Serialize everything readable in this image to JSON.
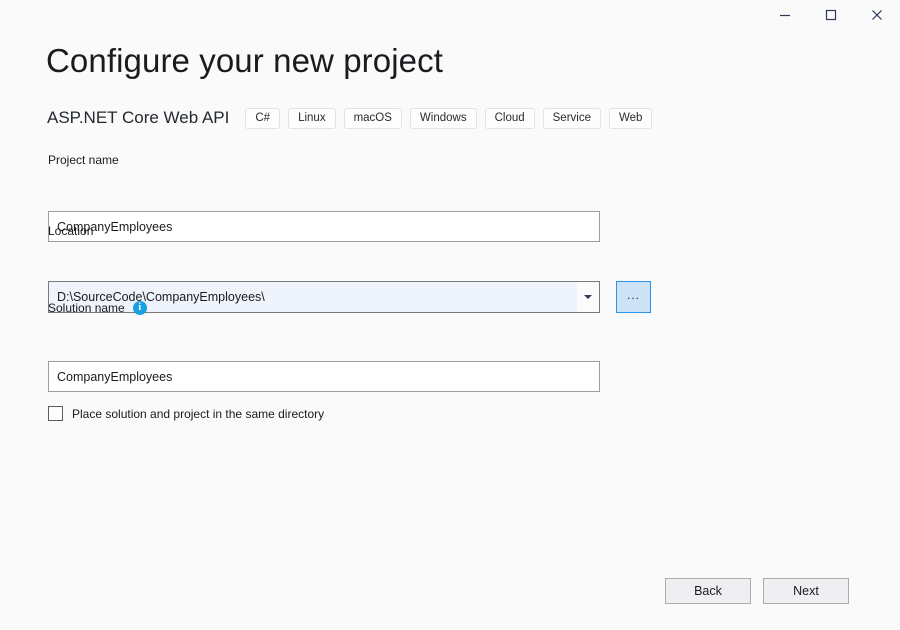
{
  "window": {
    "controls": [
      {
        "name": "minimize",
        "icon": "minimize-icon",
        "tooltip": "Minimize"
      },
      {
        "name": "maximize",
        "icon": "maximize-icon",
        "tooltip": "Maximize"
      },
      {
        "name": "close",
        "icon": "close-icon",
        "tooltip": "Close"
      }
    ]
  },
  "header": {
    "title": "Configure your new project",
    "template_name": "ASP.NET Core Web API",
    "tags": [
      "C#",
      "Linux",
      "macOS",
      "Windows",
      "Cloud",
      "Service",
      "Web"
    ]
  },
  "form": {
    "project_name": {
      "label": "Project name",
      "value": "CompanyEmployees",
      "placeholder": "Project name"
    },
    "location": {
      "label": "Location",
      "value": "D:\\SourceCode\\CompanyEmployees\\",
      "dropdown_icon": "chevron-down-icon",
      "browse_label": "...",
      "browse_icon": "ellipsis-icon"
    },
    "solution_name": {
      "label": "Solution name",
      "info_icon": "info-icon",
      "info_glyph": "i",
      "value": "CompanyEmployees",
      "placeholder": "Solution name"
    },
    "same_directory": {
      "label": "Place solution and project in the same directory",
      "checked": false
    }
  },
  "footer": {
    "back_label": "Back",
    "next_label": "Next"
  },
  "colors": {
    "page_background": "#fafafa",
    "accent_blue": "#0078d7",
    "info_blue": "#1ba1e2",
    "combo_fill": "#eff3fc",
    "browse_fill": "#cde2f7",
    "browse_border": "#2a94e8",
    "input_border": "#9e9e9e",
    "button_fill": "#efeff1",
    "button_border": "#acacb0",
    "text": "#1b1b1f"
  }
}
